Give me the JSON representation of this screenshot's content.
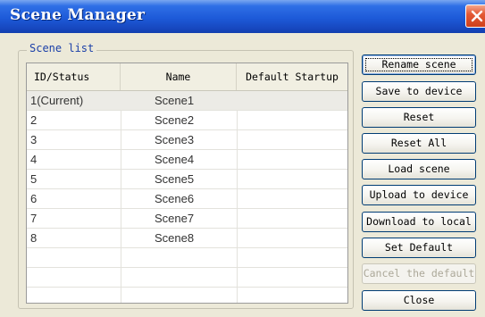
{
  "window": {
    "title": "Scene Manager"
  },
  "group": {
    "label": "Scene list"
  },
  "table": {
    "columns": [
      "ID/Status",
      "Name",
      "Default Startup"
    ],
    "rows": [
      {
        "id": "1(Current)",
        "name": "Scene1",
        "default": ""
      },
      {
        "id": "2",
        "name": "Scene2",
        "default": ""
      },
      {
        "id": "3",
        "name": "Scene3",
        "default": ""
      },
      {
        "id": "4",
        "name": "Scene4",
        "default": ""
      },
      {
        "id": "5",
        "name": "Scene5",
        "default": ""
      },
      {
        "id": "6",
        "name": "Scene6",
        "default": ""
      },
      {
        "id": "7",
        "name": "Scene7",
        "default": ""
      },
      {
        "id": "8",
        "name": "Scene8",
        "default": ""
      },
      {
        "id": "",
        "name": "",
        "default": ""
      },
      {
        "id": "",
        "name": "",
        "default": ""
      }
    ],
    "selected_row": 0
  },
  "buttons": {
    "rename": "Rename scene",
    "save": "Save to device",
    "reset": "Reset",
    "reset_all": "Reset All",
    "load": "Load scene",
    "upload": "Upload to device",
    "download": "Download to local",
    "set_default": "Set Default",
    "cancel_default": "Cancel the default",
    "close": "Close"
  },
  "colors": {
    "titlebar": "#1d5ad8",
    "close_button": "#cf3f1b",
    "dialog_bg": "#ece9d8",
    "group_label": "#1a3fa8",
    "disabled_text": "#aca899"
  },
  "icons": {
    "close": "close-icon"
  }
}
